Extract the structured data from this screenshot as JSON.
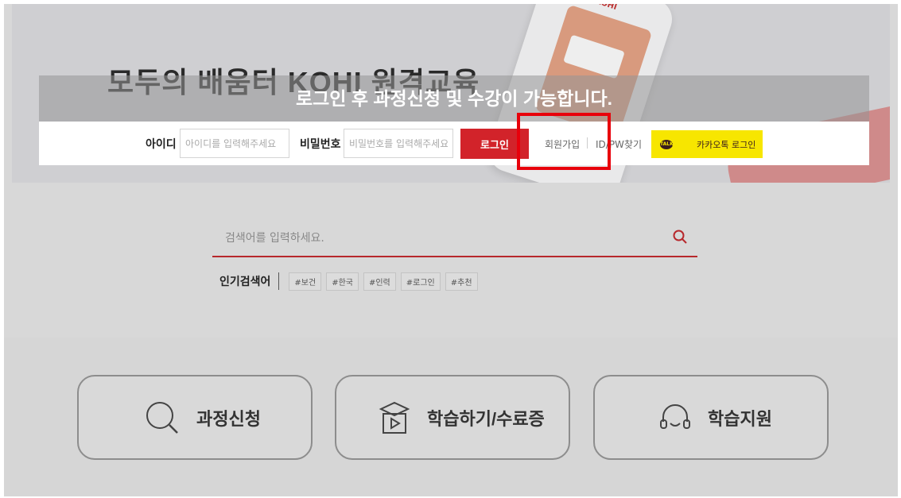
{
  "hero": {
    "title": "모두의 배움터 KOHI 원격교육",
    "subtitle": "",
    "phone_logo": "KOHI"
  },
  "overlay": {
    "message": "로그인 후 과정신청 및 수강이 가능합니다."
  },
  "login": {
    "id_label": "아이디",
    "id_placeholder": "아이디를 입력해주세요",
    "pw_label": "비밀번호",
    "pw_placeholder": "비밀번호를 입력해주세요",
    "login_button": "로그인",
    "signup_link": "회원가입",
    "find_link": "ID/PW찾기",
    "kakao_button": "카카오톡 로그인",
    "kakao_icon_text": "TALK"
  },
  "search": {
    "placeholder": "검색어를 입력하세요.",
    "popular_label": "인기검색어",
    "tags": [
      "#보건",
      "#한국",
      "#인력",
      "#로그인",
      "#추천"
    ]
  },
  "cards": [
    {
      "label": "과정신청",
      "icon": "magnifier-icon"
    },
    {
      "label": "학습하기/수료증",
      "icon": "graduation-video-icon"
    },
    {
      "label": "학습지원",
      "icon": "headset-icon"
    }
  ],
  "colors": {
    "accent_red": "#d2232a",
    "kakao_yellow": "#f7e600",
    "highlight_red": "#e8000b"
  }
}
